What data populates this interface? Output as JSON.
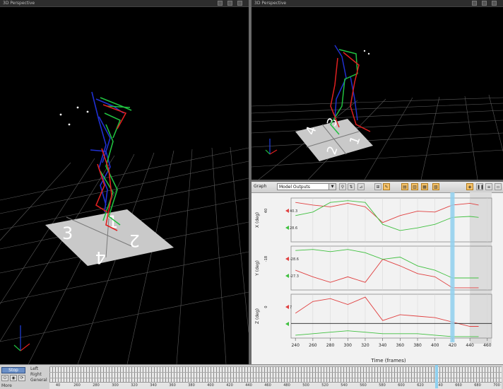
{
  "views": {
    "left": {
      "title": "3D Perspective"
    },
    "right": {
      "title": "3D Perspective"
    }
  },
  "force_plates": [
    "1",
    "2",
    "3",
    "4"
  ],
  "graph": {
    "title": "Graph",
    "dropdown_value": "Model Outputs",
    "x_axis_label": "Time (frames)",
    "x_ticks": [
      "240",
      "260",
      "280",
      "300",
      "320",
      "340",
      "360",
      "380",
      "400",
      "420",
      "440",
      "460"
    ],
    "cursor_label": "420",
    "panels": [
      {
        "ylabel": "X (deg)",
        "ytick": "40",
        "markers": [
          "40.3",
          "28.6"
        ]
      },
      {
        "ylabel": "Y (deg)",
        "ytick": "-18",
        "markers": [
          "-28.6",
          "-27.3"
        ]
      },
      {
        "ylabel": "Z (deg)",
        "ytick": "0",
        "markers": [
          "7",
          ""
        ]
      }
    ]
  },
  "chart_data": [
    {
      "type": "line",
      "ylabel": "X (deg)",
      "x": [
        240,
        260,
        280,
        300,
        320,
        340,
        360,
        380,
        400,
        420,
        440,
        450
      ],
      "ylim": [
        0,
        50
      ],
      "series": [
        {
          "values": [
            45,
            42,
            40,
            44,
            40,
            22,
            30,
            35,
            34,
            42,
            44,
            42
          ]
        },
        {
          "values": [
            30,
            34,
            45,
            47,
            45,
            20,
            13,
            16,
            20,
            28,
            29,
            28
          ]
        }
      ]
    },
    {
      "type": "line",
      "ylabel": "Y (deg)",
      "x": [
        240,
        260,
        280,
        300,
        320,
        340,
        360,
        380,
        400,
        420,
        440,
        450
      ],
      "ylim": [
        -40,
        0
      ],
      "series": [
        {
          "values": [
            -22,
            -28,
            -33,
            -28,
            -33,
            -12,
            -18,
            -25,
            -28,
            -38,
            -38,
            -38
          ]
        },
        {
          "values": [
            -4,
            -3,
            -5,
            -3,
            -6,
            -12,
            -10,
            -18,
            -22,
            -29,
            -29,
            -29
          ]
        }
      ]
    },
    {
      "type": "line",
      "ylabel": "Z (deg)",
      "x": [
        240,
        260,
        280,
        300,
        320,
        340,
        360,
        380,
        400,
        420,
        440,
        450
      ],
      "ylim": [
        -10,
        20
      ],
      "series": [
        {
          "values": [
            7,
            15,
            17,
            13,
            18,
            2,
            6,
            5,
            4,
            1,
            -2,
            -2
          ]
        },
        {
          "values": [
            -8,
            -7,
            -6,
            -5,
            -6,
            -7,
            -7,
            -7,
            -8,
            -9,
            -9,
            -9
          ]
        }
      ]
    }
  ],
  "timeline": {
    "stop_label": "Stop",
    "tracks": [
      "Left",
      "Right",
      "General"
    ],
    "more_label": "More",
    "ruler_ticks": [
      "40",
      "260",
      "280",
      "300",
      "320",
      "340",
      "360",
      "380",
      "400",
      "420",
      "440",
      "460",
      "480",
      "500",
      "520",
      "540",
      "560",
      "580",
      "600",
      "620",
      "640",
      "660",
      "680",
      "700"
    ]
  }
}
